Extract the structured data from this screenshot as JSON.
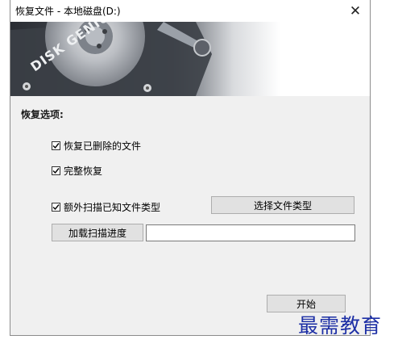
{
  "window": {
    "title": "恢复文件 - 本地磁盘(D:)",
    "close_glyph": "✕"
  },
  "banner": {
    "brand_text": "DISK GENIUS",
    "icon": "hard-drive-image"
  },
  "options": {
    "section_title": "恢复选项:",
    "recover_deleted": {
      "label": "恢复已删除的文件",
      "checked": true
    },
    "full_recovery": {
      "label": "完整恢复",
      "checked": true
    },
    "extra_scan": {
      "label": "额外扫描已知文件类型",
      "checked": true
    }
  },
  "buttons": {
    "select_file_types": "选择文件类型",
    "load_scan_progress": "加载扫描进度",
    "start": "开始"
  },
  "scan_progress_path": {
    "value": ""
  },
  "watermark": {
    "text": "最需教育"
  }
}
